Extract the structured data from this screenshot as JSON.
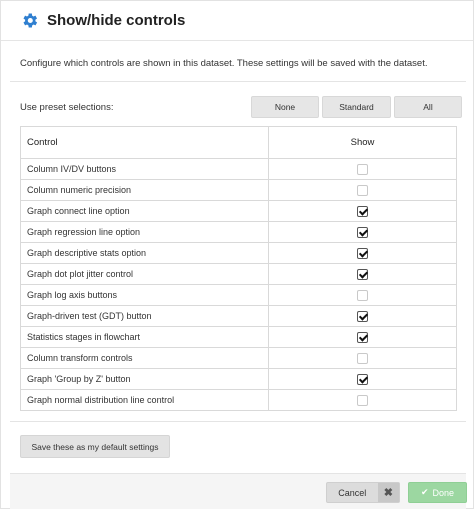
{
  "dialog": {
    "title": "Show/hide controls",
    "title_icon": "gear-icon",
    "accent_color": "#2f7fd0"
  },
  "intro_text": "Configure which controls are shown in this dataset. These settings will be saved with the dataset.",
  "presets": {
    "label": "Use preset selections:",
    "buttons": [
      "None",
      "Standard",
      "All"
    ]
  },
  "table": {
    "headers": {
      "control": "Control",
      "show": "Show"
    },
    "rows": [
      {
        "label": "Column IV/DV buttons",
        "show": false
      },
      {
        "label": "Column numeric precision",
        "show": false
      },
      {
        "label": "Graph connect line option",
        "show": true
      },
      {
        "label": "Graph regression line option",
        "show": true
      },
      {
        "label": "Graph descriptive stats option",
        "show": true
      },
      {
        "label": "Graph dot plot jitter control",
        "show": true
      },
      {
        "label": "Graph log axis buttons",
        "show": false
      },
      {
        "label": "Graph-driven test (GDT) button",
        "show": true
      },
      {
        "label": "Statistics stages in flowchart",
        "show": true
      },
      {
        "label": "Column transform controls",
        "show": false
      },
      {
        "label": "Graph 'Group by Z' button",
        "show": true
      },
      {
        "label": "Graph normal distribution line control",
        "show": false
      }
    ]
  },
  "save_default_label": "Save these as my default settings",
  "footer": {
    "cancel_label": "Cancel",
    "cancel_icon": "close-icon",
    "done_label": "Done",
    "done_icon": "check-icon",
    "done_color": "#9cd7a1"
  }
}
